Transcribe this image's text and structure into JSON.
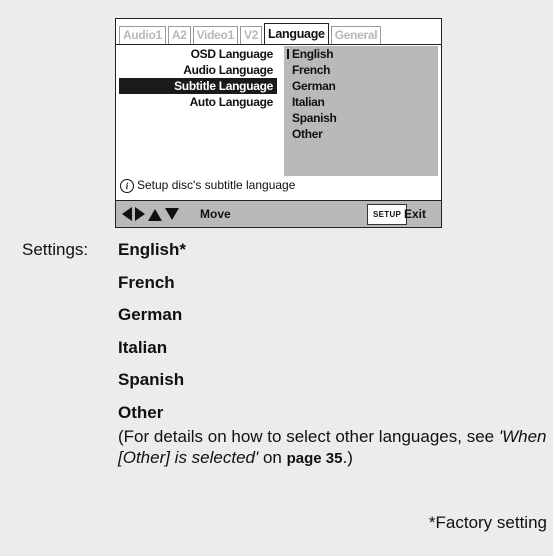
{
  "osd": {
    "tabs": [
      {
        "label": "Audio1",
        "active": false
      },
      {
        "label": "A2",
        "active": false
      },
      {
        "label": "Video1",
        "active": false
      },
      {
        "label": "V2",
        "active": false
      },
      {
        "label": "Language",
        "active": true
      },
      {
        "label": "General",
        "active": false
      }
    ],
    "menu_items": [
      {
        "label": "OSD Language",
        "selected": false
      },
      {
        "label": "Audio Language",
        "selected": false
      },
      {
        "label": "Subtitle Language",
        "selected": true
      },
      {
        "label": "Auto Language",
        "selected": false
      }
    ],
    "options": [
      {
        "label": "English",
        "current": true
      },
      {
        "label": "French",
        "current": false
      },
      {
        "label": "German",
        "current": false
      },
      {
        "label": "Italian",
        "current": false
      },
      {
        "label": "Spanish",
        "current": false
      },
      {
        "label": "Other",
        "current": false
      }
    ],
    "help_text": "Setup disc's subtitle language",
    "move_label": "Move",
    "setup_key": "SETUP",
    "exit_label": "Exit",
    "icons": {
      "info": "info-icon",
      "arrows": "direction-arrows-icon"
    }
  },
  "settings": {
    "label": "Settings:",
    "values": [
      "English*",
      "French",
      "German",
      "Italian",
      "Spanish",
      "Other"
    ],
    "note_before": "(For details on how to select other languages, see ",
    "note_link": "'When [Other] is selected'",
    "note_mid": " on ",
    "note_page": "page 35",
    "note_after": ".)",
    "footnote": "*Factory setting"
  }
}
